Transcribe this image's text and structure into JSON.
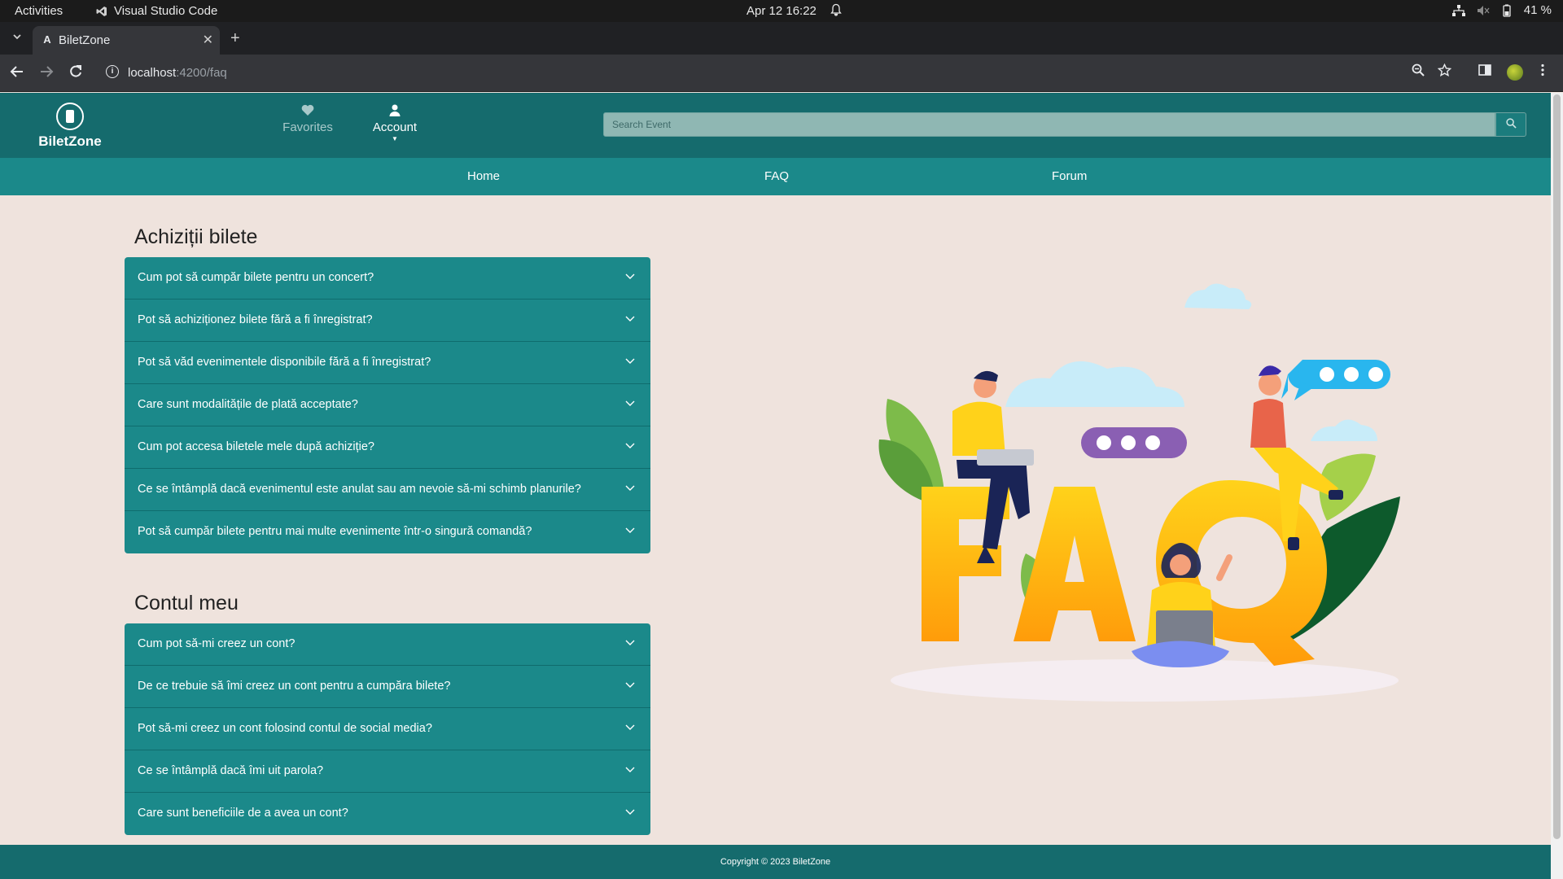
{
  "os": {
    "activities": "Activities",
    "app_name": "Visual Studio Code",
    "clock": "Apr 12  16:22",
    "battery": "41 %"
  },
  "browser": {
    "tab_title": "BiletZone",
    "url_host": "localhost",
    "url_path": ":4200/faq"
  },
  "site": {
    "logo_name": "BiletZone",
    "favorites_label": "Favorites",
    "account_label": "Account",
    "search_placeholder": "Search Event",
    "nav": [
      "Home",
      "FAQ",
      "Forum"
    ],
    "footer": "Copyright © 2023 BiletZone"
  },
  "faq": {
    "sections": [
      {
        "title": "Achiziții bilete",
        "questions": [
          "Cum pot să cumpăr bilete pentru un concert?",
          "Pot să achiziționez bilete fără a fi înregistrat?",
          "Pot să văd evenimentele disponibile fără a fi înregistrat?",
          "Care sunt modalitățile de plată acceptate?",
          "Cum pot accesa biletele mele după achiziție?",
          "Ce se întâmplă dacă evenimentul este anulat sau am nevoie să-mi schimb planurile?",
          "Pot să cumpăr bilete pentru mai multe evenimente într-o singură comandă?"
        ]
      },
      {
        "title": "Contul meu",
        "questions": [
          "Cum pot să-mi creez un cont?",
          "De ce trebuie să îmi creez un cont pentru a cumpăra bilete?",
          "Pot să-mi creez un cont folosind contul de social media?",
          "Ce se întâmplă dacă îmi uit parola?",
          "Care sunt beneficiile de a avea un cont?"
        ]
      }
    ]
  },
  "illustration_text": "FAQ",
  "colors": {
    "header": "#156b6d",
    "navbar": "#1b898a",
    "accordion": "#1b898a",
    "page_bg": "#efe3dd"
  }
}
